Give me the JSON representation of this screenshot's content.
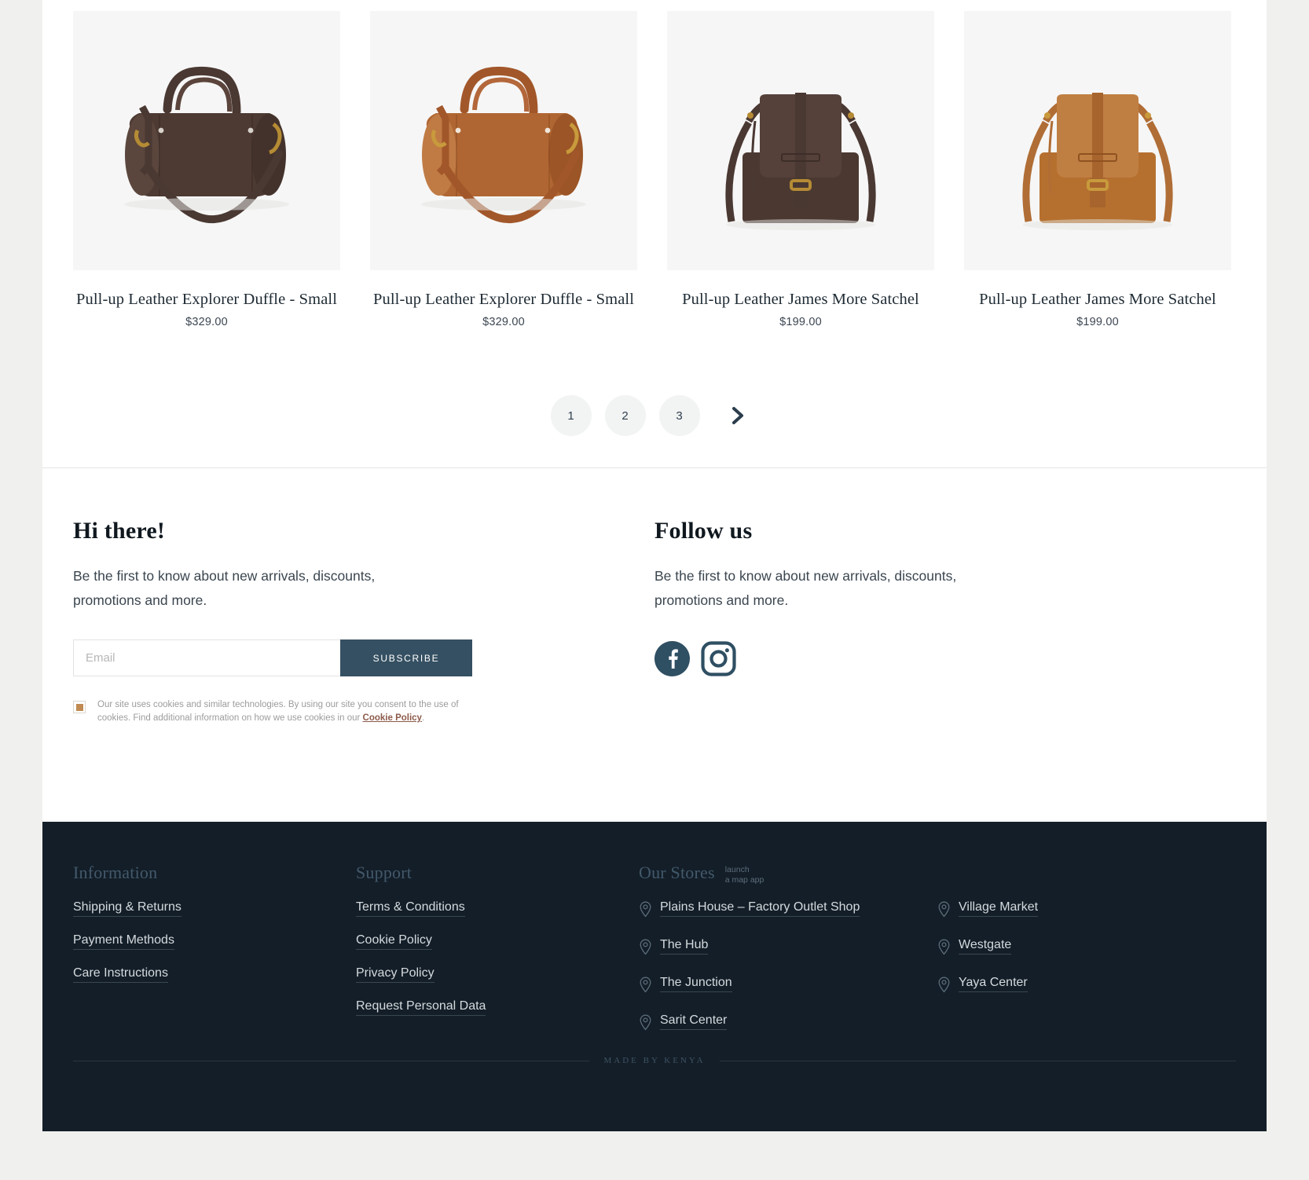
{
  "products": [
    {
      "title": "Pull-up Leather Explorer Duffle - Small",
      "price": "$329.00",
      "image": "duffle-dark-brown"
    },
    {
      "title": "Pull-up Leather Explorer Duffle - Small",
      "price": "$329.00",
      "image": "duffle-tan"
    },
    {
      "title": "Pull-up Leather James More Satchel",
      "price": "$199.00",
      "image": "satchel-dark-brown"
    },
    {
      "title": "Pull-up Leather James More Satchel",
      "price": "$199.00",
      "image": "satchel-tan"
    }
  ],
  "pagination": {
    "pages": [
      "1",
      "2",
      "3"
    ],
    "next_icon": "chevron-right-icon"
  },
  "newsletter": {
    "heading": "Hi there!",
    "text": "Be the first to know about new arrivals, discounts, promotions and more.",
    "email_placeholder": "Email",
    "email_value": "",
    "subscribe_label": "SUBSCRIBE",
    "cookie_text_1": "Our site uses cookies and similar technologies. By using our site you consent to the use of cookies. Find additional information on how we use cookies in our ",
    "cookie_link": "Cookie Policy",
    "cookie_text_2": "."
  },
  "follow": {
    "heading": "Follow us",
    "text": "Be the first to know about new arrivals, discounts, promotions and more.",
    "social": [
      {
        "name": "facebook-icon",
        "label": "Facebook"
      },
      {
        "name": "instagram-icon",
        "label": "Instagram"
      }
    ]
  },
  "footer": {
    "information": {
      "heading": "Information",
      "links": [
        "Shipping & Returns",
        "Payment Methods",
        "Care Instructions"
      ]
    },
    "support": {
      "heading": "Support",
      "links": [
        "Terms & Conditions",
        "Cookie Policy",
        "Privacy Policy",
        "Request Personal Data"
      ]
    },
    "stores": {
      "heading": "Our Stores",
      "maps_note_line1": "launch",
      "maps_note_line2": "a map app",
      "column_left": [
        "Plains House – Factory Outlet Shop",
        "The Hub",
        "The Junction",
        "Sarit Center"
      ],
      "column_right": [
        "Village Market",
        "Westgate",
        "Yaya Center"
      ]
    },
    "made_by": "MADE BY KENYA"
  },
  "colors": {
    "accent_dark": "#355062",
    "footer_bg": "#131e28",
    "cookie_accent": "#c08a52",
    "cookie_link": "#8c5a4a"
  }
}
